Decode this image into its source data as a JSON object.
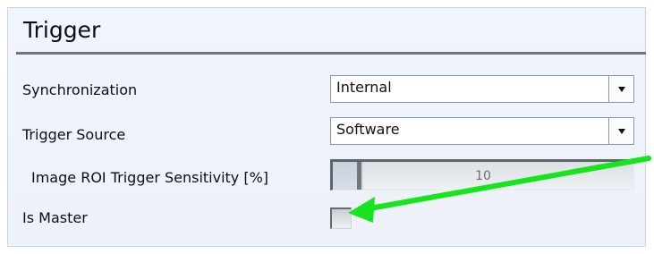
{
  "panel": {
    "title": "Trigger"
  },
  "fields": [
    {
      "label": "Synchronization",
      "value": "Internal"
    },
    {
      "label": "Trigger Source",
      "value": "Software"
    },
    {
      "label": "Image ROI Trigger Sensitivity [%]",
      "value": "10",
      "level": 0.1
    },
    {
      "label": "Is Master",
      "checked": false
    }
  ],
  "colors": {
    "arrow": "#16e51d",
    "header_rule": "#6f7479",
    "panel_background": "#edf2f8"
  },
  "icons": {
    "dropdown": "chevron-down-icon",
    "annotation": "arrow-icon"
  }
}
